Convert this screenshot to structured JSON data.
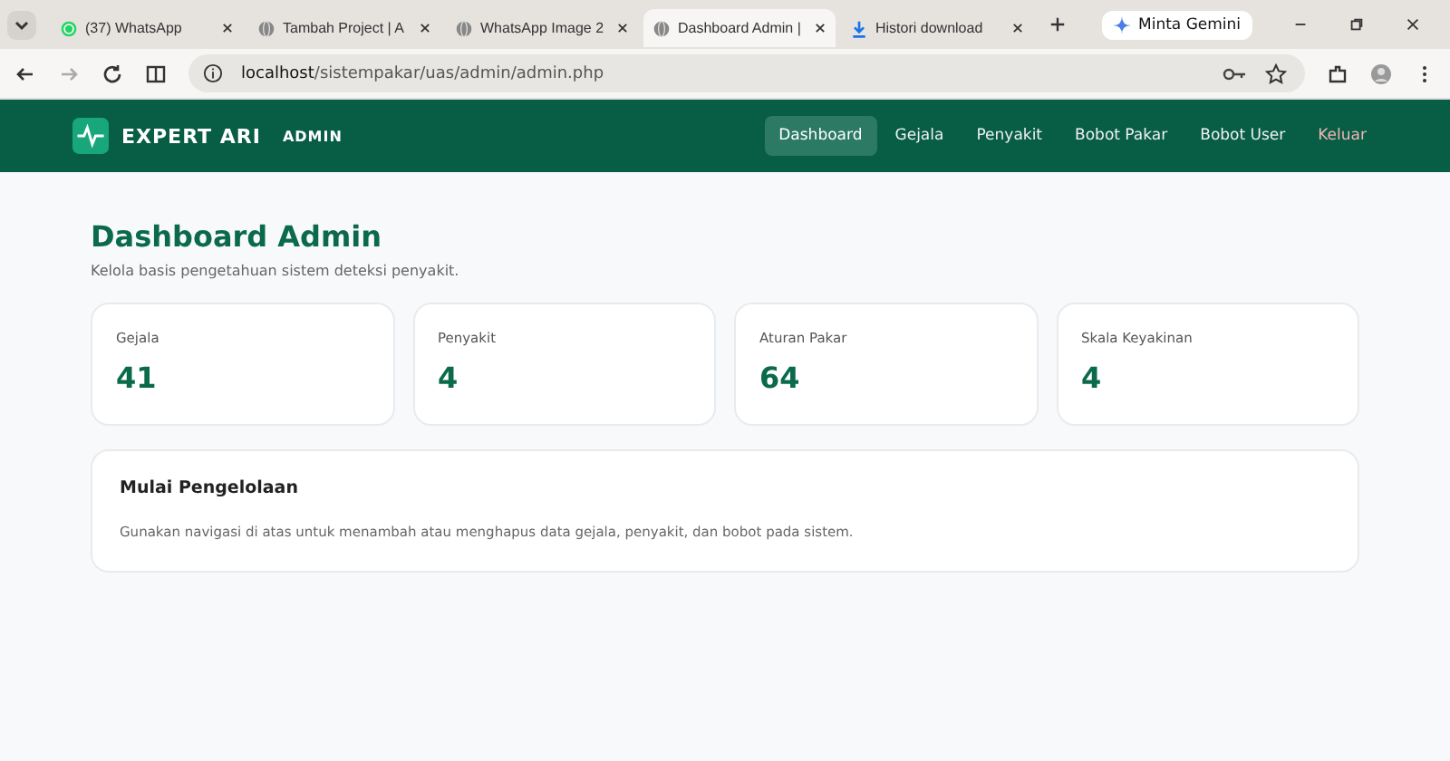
{
  "browser": {
    "tabs": [
      {
        "title": "(37) WhatsApp",
        "kind": "whatsapp",
        "selected": false
      },
      {
        "title": "Tambah Project | A",
        "kind": "globe",
        "selected": false
      },
      {
        "title": "WhatsApp Image 2",
        "kind": "globe",
        "selected": false
      },
      {
        "title": "Dashboard Admin |",
        "kind": "globe",
        "selected": true
      },
      {
        "title": "Histori download",
        "kind": "download",
        "selected": false
      }
    ],
    "gemini_button": "Minta Gemini",
    "url_host": "localhost",
    "url_path": "/sistempakar/uas/admin/admin.php"
  },
  "navbar": {
    "brand": "EXPERT ARI",
    "badge": "ADMIN",
    "items": [
      {
        "label": "Dashboard",
        "selected": true,
        "kind": "link"
      },
      {
        "label": "Gejala",
        "selected": false,
        "kind": "link"
      },
      {
        "label": "Penyakit",
        "selected": false,
        "kind": "link"
      },
      {
        "label": "Bobot Pakar",
        "selected": false,
        "kind": "link"
      },
      {
        "label": "Bobot User",
        "selected": false,
        "kind": "link"
      },
      {
        "label": "Keluar",
        "selected": false,
        "kind": "logout"
      }
    ]
  },
  "page": {
    "title": "Dashboard Admin",
    "subtitle": "Kelola basis pengetahuan sistem deteksi penyakit.",
    "stats": [
      {
        "label": "Gejala",
        "value": "41"
      },
      {
        "label": "Penyakit",
        "value": "4"
      },
      {
        "label": "Aturan Pakar",
        "value": "64"
      },
      {
        "label": "Skala Keyakinan",
        "value": "4"
      }
    ],
    "info": {
      "title": "Mulai Pengelolaan",
      "text": "Gunakan navigasi di atas untuk menambah atau menghapus data gejala, penyakit, dan bobot pada sistem."
    }
  }
}
